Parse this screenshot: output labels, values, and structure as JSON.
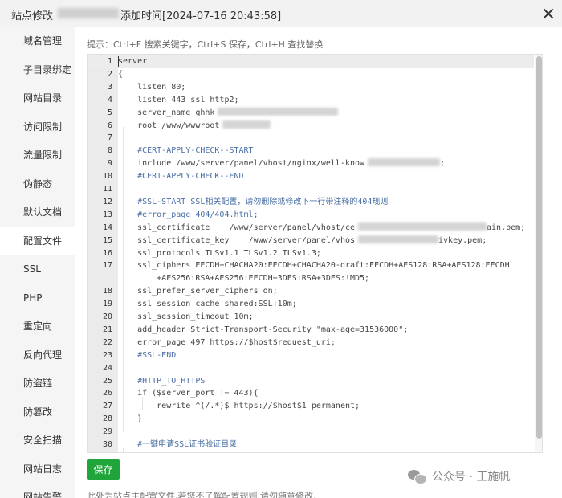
{
  "window": {
    "title_prefix": "站点修改",
    "title_suffix": "添加时间[2024-07-16 20:43:58]"
  },
  "sidebar": {
    "items": [
      {
        "label": "域名管理"
      },
      {
        "label": "子目录绑定"
      },
      {
        "label": "网站目录"
      },
      {
        "label": "访问限制"
      },
      {
        "label": "流量限制"
      },
      {
        "label": "伪静态"
      },
      {
        "label": "默认文档"
      },
      {
        "label": "配置文件",
        "active": true
      },
      {
        "label": "SSL"
      },
      {
        "label": "PHP"
      },
      {
        "label": "重定向"
      },
      {
        "label": "反向代理"
      },
      {
        "label": "防盗链"
      },
      {
        "label": "防篡改"
      },
      {
        "label": "安全扫描"
      },
      {
        "label": "网站日志"
      },
      {
        "label": "网站告警"
      }
    ]
  },
  "editor": {
    "hint": "提示：Ctrl+F 搜索关键字，Ctrl+S 保存，Ctrl+H 查找替换",
    "lines": [
      {
        "num": "1",
        "text": "server"
      },
      {
        "num": "2",
        "text": "{"
      },
      {
        "num": "3",
        "text": "    listen 80;"
      },
      {
        "num": "4",
        "text": "    listen 443 ssl http2;"
      },
      {
        "num": "5",
        "text": "    server_name qhhk"
      },
      {
        "num": "6",
        "text": "    root /www/wwwroot"
      },
      {
        "num": "7",
        "text": ""
      },
      {
        "num": "8",
        "text": "    #CERT-APPLY-CHECK--START"
      },
      {
        "num": "9",
        "text": "    include /www/server/panel/vhost/nginx/well-know",
        "tail": ";"
      },
      {
        "num": "10",
        "text": "    #CERT-APPLY-CHECK--END"
      },
      {
        "num": "11",
        "text": ""
      },
      {
        "num": "12",
        "text": "    #SSL-START SSL相关配置，请勿删除或修改下一行带注释的404规则"
      },
      {
        "num": "13",
        "text": "    #error_page 404/404.html;"
      },
      {
        "num": "14",
        "text": "    ssl_certificate    /www/server/panel/vhost/ce",
        "tail": "ain.pem;"
      },
      {
        "num": "15",
        "text": "    ssl_certificate_key    /www/server/panel/vhos",
        "tail": "ivkey.pem;"
      },
      {
        "num": "16",
        "text": "    ssl_protocols TLSv1.1 TLSv1.2 TLSv1.3;"
      },
      {
        "num": "17",
        "text": "    ssl_ciphers EECDH+CHACHA20:EECDH+CHACHA20-draft:EECDH+AES128:RSA+AES128:EECDH"
      },
      {
        "num": "",
        "text": "        +AES256:RSA+AES256:EECDH+3DES:RSA+3DES:!MD5;"
      },
      {
        "num": "18",
        "text": "    ssl_prefer_server_ciphers on;"
      },
      {
        "num": "19",
        "text": "    ssl_session_cache shared:SSL:10m;"
      },
      {
        "num": "20",
        "text": "    ssl_session_timeout 10m;"
      },
      {
        "num": "21",
        "text": "    add_header Strict-Transport-Security \"max-age=31536000\";"
      },
      {
        "num": "22",
        "text": "    error_page 497 https://$host$request_uri;"
      },
      {
        "num": "23",
        "text": "    #SSL-END"
      },
      {
        "num": "24",
        "text": ""
      },
      {
        "num": "25",
        "text": "    #HTTP_TO_HTTPS"
      },
      {
        "num": "26",
        "text": "    if ($server_port !~ 443){"
      },
      {
        "num": "27",
        "text": "        rewrite ^(/.*)$ https://$host$1 permanent;"
      },
      {
        "num": "28",
        "text": "    }"
      },
      {
        "num": "29",
        "text": ""
      },
      {
        "num": "30",
        "text": "    #一键申请SSL证书验证目录"
      }
    ]
  },
  "actions": {
    "save_label": "保存"
  },
  "footer": {
    "note": "此处为站点主配置文件,若您不了解配置规则,请勿随意修改."
  },
  "watermark": {
    "text": "公众号 · 王施帆"
  },
  "colors": {
    "save_button": "#20a53a",
    "comment": "#4a6fa5",
    "sidebar_bg": "#f5f5f5",
    "gutter_bg": "#ebebeb"
  }
}
